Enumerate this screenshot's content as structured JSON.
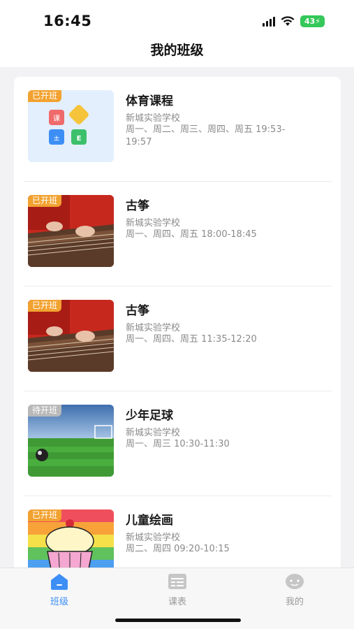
{
  "status_bar": {
    "time": "16:45",
    "battery": "43"
  },
  "header": {
    "title": "我的班级"
  },
  "classes": [
    {
      "badge": "已开班",
      "badge_state": "open",
      "title": "体育课程",
      "school": "新城实验学校",
      "schedule": "周一、周二、周三、周四、周五 19:53-19:57",
      "thumbnail": "blocks-illustration"
    },
    {
      "badge": "已开班",
      "badge_state": "open",
      "title": "古筝",
      "school": "新城实验学校",
      "schedule": "周一、周四、周五 18:00-18:45",
      "thumbnail": "guzheng-photo"
    },
    {
      "badge": "已开班",
      "badge_state": "open",
      "title": "古筝",
      "school": "新城实验学校",
      "schedule": "周一、周四、周五 11:35-12:20",
      "thumbnail": "guzheng-photo"
    },
    {
      "badge": "待开班",
      "badge_state": "pending",
      "title": "少年足球",
      "school": "新城实验学校",
      "schedule": "周一、周三 10:30-11:30",
      "thumbnail": "football-field-photo"
    },
    {
      "badge": "已开班",
      "badge_state": "open",
      "title": "儿童绘画",
      "school": "新城实验学校",
      "schedule": "周二、周四 09:20-10:15",
      "thumbnail": "cupcake-drawing"
    }
  ],
  "tabs": [
    {
      "label": "班级",
      "icon": "home-icon",
      "active": true
    },
    {
      "label": "课表",
      "icon": "schedule-icon",
      "active": false
    },
    {
      "label": "我的",
      "icon": "profile-icon",
      "active": false
    }
  ],
  "colors": {
    "accent": "#3d8ff5",
    "badge_open": "#f2a230",
    "badge_pending": "#b9b9b9",
    "inactive_tab": "#9a9a9a"
  }
}
